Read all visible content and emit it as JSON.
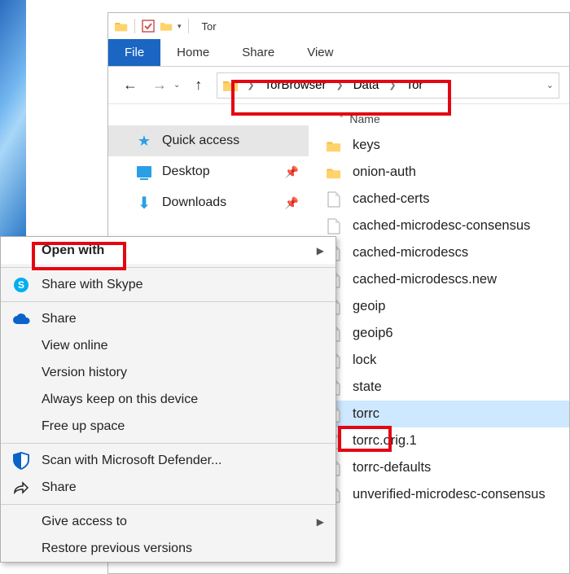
{
  "window": {
    "title": "Tor"
  },
  "ribbon": {
    "file": "File",
    "tabs": [
      "Home",
      "Share",
      "View"
    ]
  },
  "nav": {
    "breadcrumbs": [
      "TorBrowser",
      "Data",
      "Tor"
    ]
  },
  "sidebar": {
    "items": [
      {
        "label": "Quick access",
        "icon": "star",
        "active": true
      },
      {
        "label": "Desktop",
        "icon": "monitor",
        "pinned": true
      },
      {
        "label": "Downloads",
        "icon": "download",
        "pinned": true
      }
    ]
  },
  "list": {
    "column": "Name",
    "files": [
      {
        "name": "keys",
        "type": "folder"
      },
      {
        "name": "onion-auth",
        "type": "folder"
      },
      {
        "name": "cached-certs",
        "type": "file"
      },
      {
        "name": "cached-microdesc-consensus",
        "type": "file"
      },
      {
        "name": "cached-microdescs",
        "type": "file"
      },
      {
        "name": "cached-microdescs.new",
        "type": "file"
      },
      {
        "name": "geoip",
        "type": "file"
      },
      {
        "name": "geoip6",
        "type": "file"
      },
      {
        "name": "lock",
        "type": "file"
      },
      {
        "name": "state",
        "type": "file"
      },
      {
        "name": "torrc",
        "type": "file",
        "selected": true
      },
      {
        "name": "torrc.orig.1",
        "type": "file"
      },
      {
        "name": "torrc-defaults",
        "type": "file"
      },
      {
        "name": "unverified-microdesc-consensus",
        "type": "file"
      }
    ]
  },
  "context_menu": {
    "open_with": "Open with",
    "skype": "Share with Skype",
    "share": "Share",
    "view_online": "View online",
    "version_history": "Version history",
    "always_keep": "Always keep on this device",
    "free_up": "Free up space",
    "defender": "Scan with Microsoft Defender...",
    "share2": "Share",
    "give_access": "Give access to",
    "restore": "Restore previous versions"
  }
}
